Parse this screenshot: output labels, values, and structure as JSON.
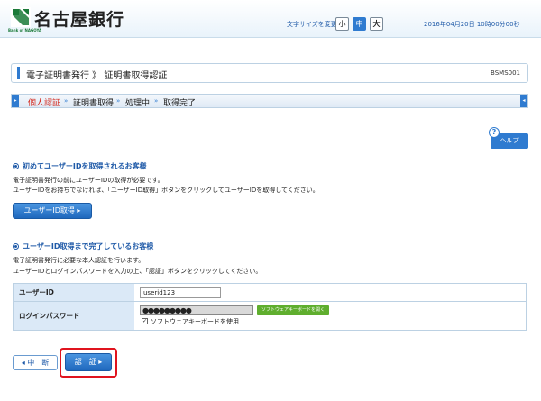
{
  "header": {
    "bank_name": "名古屋銀行",
    "bank_sub": "Bank of NAGOYA",
    "fontsize_label": "文字サイズを変更",
    "fontsize_small": "小",
    "fontsize_mid": "中",
    "fontsize_large": "大",
    "datetime": "2016年04月20日 10時00分00秒"
  },
  "title": {
    "text": "電子証明書発行 》 証明書取得認証",
    "screen_id": "BSMS001"
  },
  "steps": [
    {
      "label": "個人認証",
      "active": true
    },
    {
      "label": "証明書取得",
      "active": false
    },
    {
      "label": "処理中",
      "active": false
    },
    {
      "label": "取得完了",
      "active": false
    }
  ],
  "step_separator": "»",
  "help": {
    "label": "ヘルプ",
    "icon": "question-icon",
    "glyph": "?"
  },
  "section1": {
    "title": "初めてユーザーIDを取得されるお客様",
    "desc1": "電子証明書発行の前にユーザーIDの取得が必要です。",
    "desc2": "ユーザーIDをお持ちでなければ、「ユーザーID取得」ボタンをクリックしてユーザーIDを取得してください。",
    "button": "ユーザーID取得 ▸"
  },
  "section2": {
    "title": "ユーザーID取得まで完了しているお客様",
    "desc1": "電子証明書発行に必要な本人認証を行います。",
    "desc2": "ユーザーIDとログインパスワードを入力の上、「認証」ボタンをクリックしてください。"
  },
  "form": {
    "userid_label": "ユーザーID",
    "userid_value": "userid123",
    "password_label": "ログインパスワード",
    "password_value": "●●●●●●●●●",
    "swkb_button": "ソフトウェアキーボードを開く",
    "swkb_checkbox_label": "ソフトウェアキーボードを使用",
    "swkb_checked": true,
    "check_glyph": "✓"
  },
  "actions": {
    "cancel": "◂ 中　断",
    "auth": "認　証 ▸"
  },
  "colors": {
    "accent": "#2f7bd0",
    "active_step": "#d42a1f",
    "highlight": "#e0141e"
  }
}
